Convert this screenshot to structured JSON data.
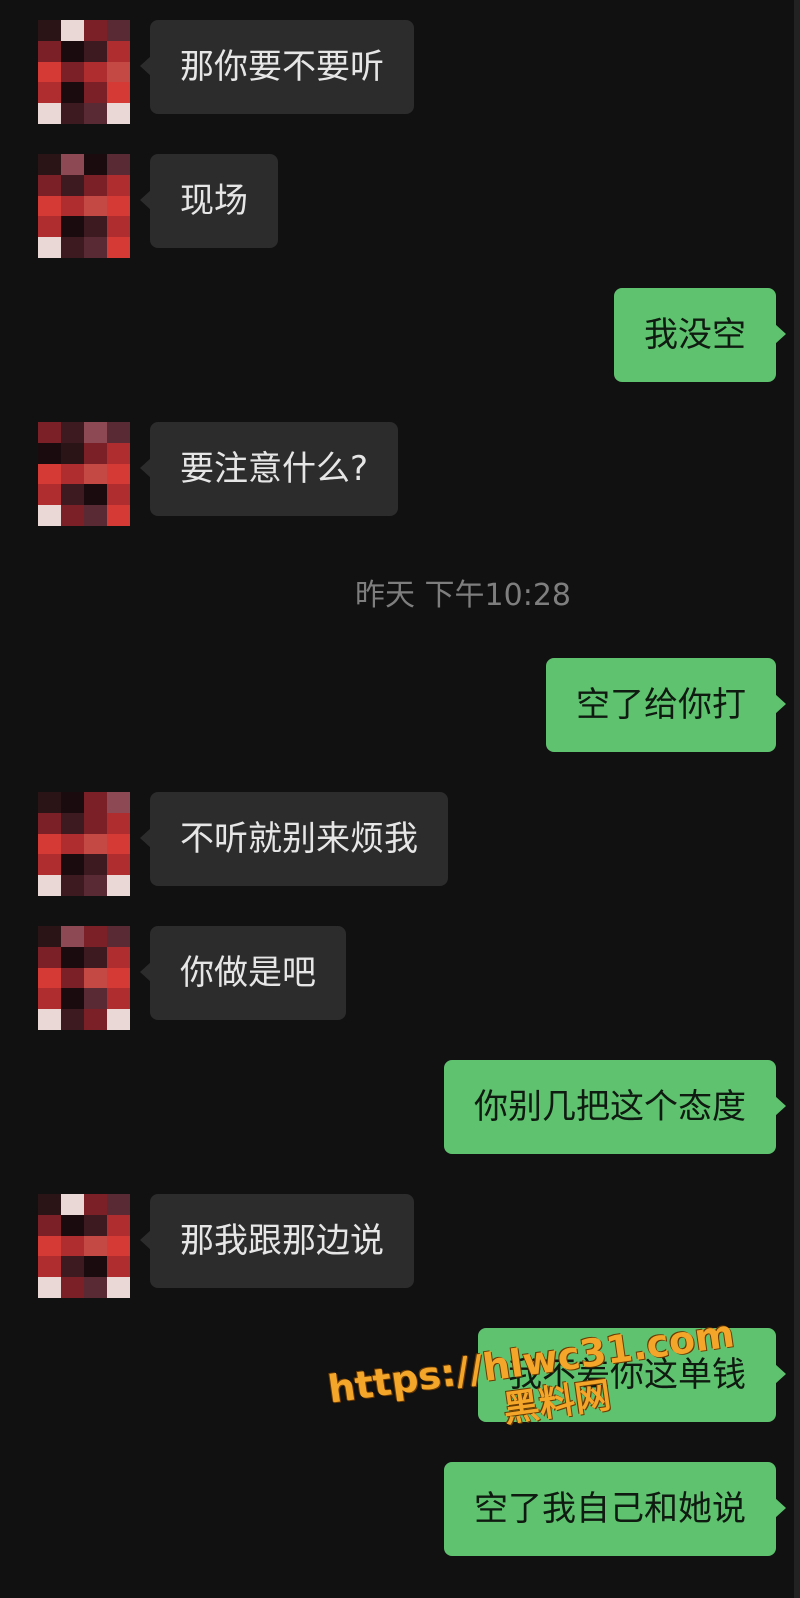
{
  "messages": [
    {
      "side": "in",
      "text": "那你要不要听"
    },
    {
      "side": "in",
      "text": "现场"
    },
    {
      "side": "out",
      "text": "我没空"
    },
    {
      "side": "in",
      "text": "要注意什么?"
    },
    {
      "side": "out",
      "text": "空了给你打"
    },
    {
      "side": "in",
      "text": "不听就别来烦我"
    },
    {
      "side": "in",
      "text": "你做是吧"
    },
    {
      "side": "out",
      "text": "你别几把这个态度"
    },
    {
      "side": "in",
      "text": "那我跟那边说"
    },
    {
      "side": "out",
      "text": "我不差你这单钱"
    },
    {
      "side": "out",
      "text": "空了我自己和她说"
    }
  ],
  "timestamp": "昨天 下午10:28",
  "watermark": {
    "url": "https://hlwc31.com",
    "name": "黑料网"
  },
  "colors": {
    "background": "#111111",
    "incoming_bubble": "#2c2c2c",
    "outgoing_bubble": "#5ec26f",
    "watermark": "#f3a62a"
  }
}
